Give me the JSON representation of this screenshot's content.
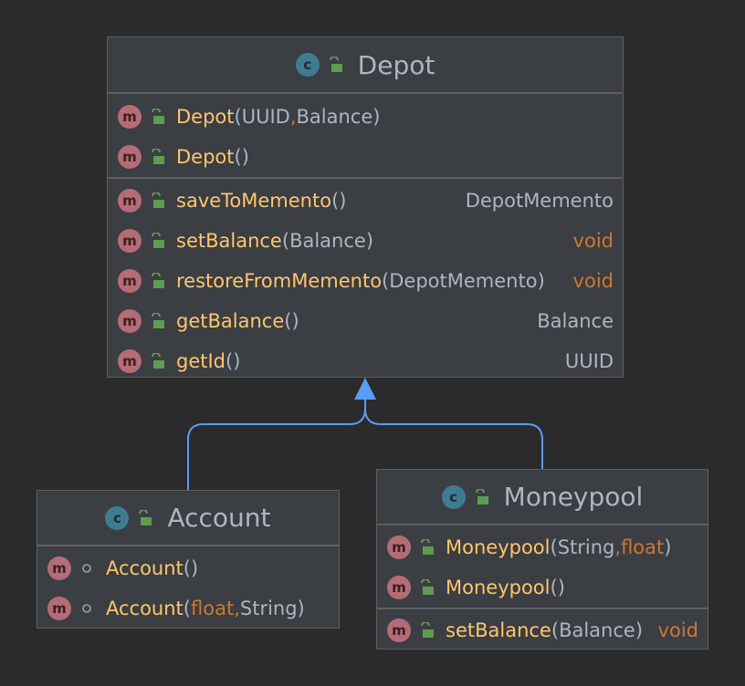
{
  "depot": {
    "name": "Depot",
    "constructors": [
      {
        "name": "Depot",
        "params": [
          {
            "text": "UUID",
            "kw": false
          },
          {
            "text": "Balance",
            "kw": false
          }
        ],
        "return": ""
      },
      {
        "name": "Depot",
        "params": [],
        "return": ""
      }
    ],
    "methods": [
      {
        "name": "saveToMemento",
        "params": [],
        "return": "DepotMemento",
        "return_kw": false
      },
      {
        "name": "setBalance",
        "params": [
          {
            "text": "Balance",
            "kw": false
          }
        ],
        "return": "void",
        "return_kw": true
      },
      {
        "name": "restoreFromMemento",
        "params": [
          {
            "text": "DepotMemento",
            "kw": false
          }
        ],
        "return": "void",
        "return_kw": true
      },
      {
        "name": "getBalance",
        "params": [],
        "return": "Balance",
        "return_kw": false
      },
      {
        "name": "getId",
        "params": [],
        "return": "UUID",
        "return_kw": false
      }
    ]
  },
  "account": {
    "name": "Account",
    "constructors": [
      {
        "name": "Account",
        "params": [],
        "return": ""
      },
      {
        "name": "Account",
        "params": [
          {
            "text": "float",
            "kw": true
          },
          {
            "text": "String",
            "kw": false
          }
        ],
        "return": ""
      }
    ],
    "methods": []
  },
  "moneypool": {
    "name": "Moneypool",
    "constructors": [
      {
        "name": "Moneypool",
        "params": [
          {
            "text": "String",
            "kw": false
          },
          {
            "text": "float",
            "kw": true
          }
        ],
        "return": ""
      },
      {
        "name": "Moneypool",
        "params": [],
        "return": ""
      }
    ],
    "methods": [
      {
        "name": "setBalance",
        "params": [
          {
            "text": "Balance",
            "kw": false
          }
        ],
        "return": "void",
        "return_kw": true
      }
    ]
  },
  "icons": {
    "class_badge": "c",
    "method_badge": "m",
    "public_icon": "open-lock-icon",
    "package_icon": "package-private-dot-icon"
  },
  "colors": {
    "background": "#2b2b2b",
    "box": "#3b3e42",
    "border": "#5e6060",
    "method_name": "#ffc66d",
    "keyword": "#cc7832",
    "text": "#a9b7c6",
    "arrow": "#589df6"
  }
}
